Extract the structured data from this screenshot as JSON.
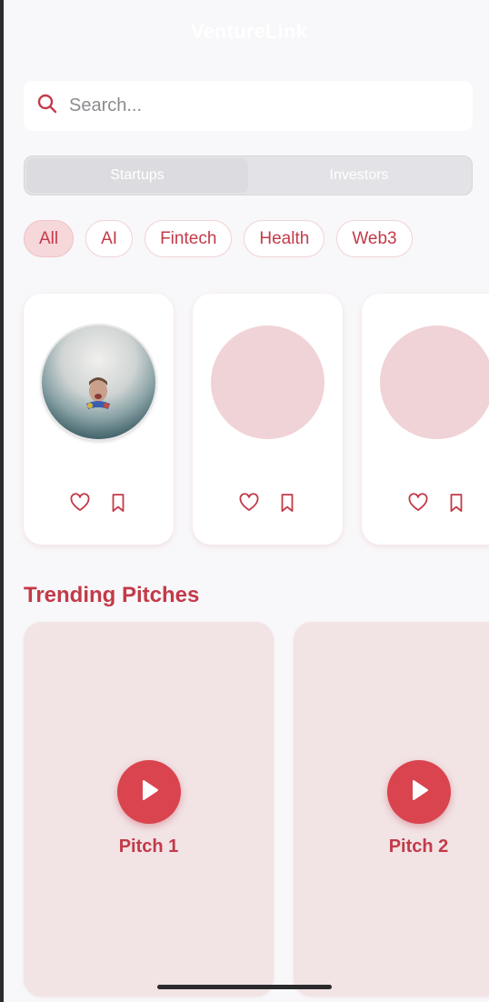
{
  "header": {
    "title": "VentureLink"
  },
  "search": {
    "placeholder": "Search...",
    "value": "",
    "icon": "search-icon"
  },
  "tabs": [
    {
      "label": "Startups",
      "active": true
    },
    {
      "label": "Investors",
      "active": false
    }
  ],
  "filters": [
    {
      "label": "All",
      "active": true
    },
    {
      "label": "AI",
      "active": false
    },
    {
      "label": "Fintech",
      "active": false
    },
    {
      "label": "Health",
      "active": false
    },
    {
      "label": "Web3",
      "active": false
    }
  ],
  "startups": [
    {
      "avatar": "photo",
      "actions": [
        "heart-icon",
        "bookmark-icon"
      ]
    },
    {
      "avatar": "placeholder",
      "actions": [
        "heart-icon",
        "bookmark-icon"
      ]
    },
    {
      "avatar": "placeholder",
      "actions": [
        "heart-icon",
        "bookmark-icon"
      ]
    }
  ],
  "trending": {
    "title": "Trending Pitches",
    "pitches": [
      {
        "label": "Pitch 1",
        "icon": "play-icon"
      },
      {
        "label": "Pitch 2",
        "icon": "play-icon"
      }
    ]
  },
  "colors": {
    "accent": "#c33a48",
    "play_button": "#d9444f",
    "chip_active_bg": "#f6d7da",
    "pitch_card_bg": "#f2e3e5",
    "avatar_placeholder": "#f0d3d6"
  }
}
